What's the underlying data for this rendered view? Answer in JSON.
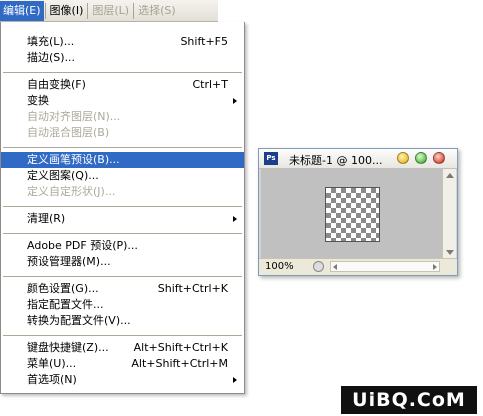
{
  "menubar": {
    "items": [
      {
        "label": "编辑(E)",
        "state": "active"
      },
      {
        "label": "图像(I)",
        "state": "normal"
      },
      {
        "label": "图层(L)",
        "state": "dim"
      },
      {
        "label": "选择(S)",
        "state": "dim"
      }
    ]
  },
  "menu": {
    "groups": [
      [
        {
          "label": "填充(L)...",
          "shortcut": "Shift+F5"
        },
        {
          "label": "描边(S)..."
        }
      ],
      [
        {
          "label": "自由变换(F)",
          "shortcut": "Ctrl+T"
        },
        {
          "label": "变换",
          "submenu": true
        },
        {
          "label": "自动对齐图层(N)...",
          "disabled": true
        },
        {
          "label": "自动混合图层(B)",
          "disabled": true
        }
      ],
      [
        {
          "label": "定义画笔预设(B)...",
          "highlighted": true
        },
        {
          "label": "定义图案(Q)..."
        },
        {
          "label": "定义自定形状(J)...",
          "disabled": true
        }
      ],
      [
        {
          "label": "清理(R)",
          "submenu": true
        }
      ],
      [
        {
          "label": "Adobe PDF 预设(P)..."
        },
        {
          "label": "预设管理器(M)..."
        }
      ],
      [
        {
          "label": "颜色设置(G)...",
          "shortcut": "Shift+Ctrl+K"
        },
        {
          "label": "指定配置文件..."
        },
        {
          "label": "转换为配置文件(V)..."
        }
      ],
      [
        {
          "label": "键盘快捷键(Z)...",
          "shortcut": "Alt+Shift+Ctrl+K"
        },
        {
          "label": "菜单(U)...",
          "shortcut": "Alt+Shift+Ctrl+M"
        },
        {
          "label": "首选项(N)",
          "submenu": true
        }
      ]
    ]
  },
  "document": {
    "app_icon_text": "Ps",
    "title": "未标题-1 @ 100...",
    "zoom": "100%"
  },
  "watermark": {
    "text": "UiBQ.CoM"
  },
  "colors": {
    "highlight": "#316ac5",
    "disabled": "#aca899"
  }
}
